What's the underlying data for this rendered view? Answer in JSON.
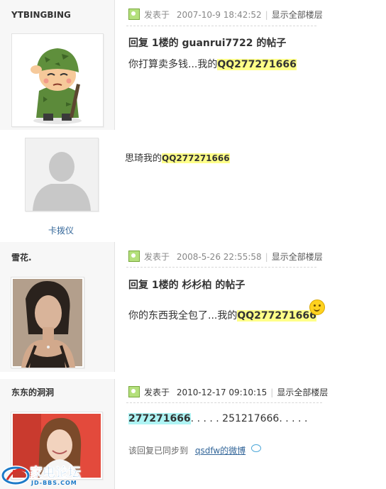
{
  "posts": [
    {
      "username": "YTBINGBING",
      "posted_prefix": "发表于",
      "posted_time": "2007-10-9 18:42:52",
      "show_all": "显示全部楼层",
      "title": "回复  1楼的  guanrui7722 的帖子",
      "body_prefix": "你打算卖多钱...我的",
      "body_qq": "QQ277271666"
    },
    {
      "username": "卡拨仪",
      "body_prefix": "思琦我的",
      "body_qq": "QQ277271666"
    },
    {
      "username": "雪花.",
      "posted_prefix": "发表于",
      "posted_time": "2008-5-26 22:55:58",
      "show_all": "显示全部楼层",
      "title": "回复  1楼的  杉杉柏  的帖子",
      "body_prefix": "你的东西我全包了...我的",
      "body_qq": "QQ277271666"
    },
    {
      "username": "东东的洞洞",
      "posted_prefix": "发表于",
      "posted_time": "2010-12-17 09:10:15",
      "show_all": "显示全部楼层",
      "body_qq": "277271666",
      "body_rest": ". .  .  .  .  251217666. .  .  .  .",
      "sync_prefix": "该回复已同步到",
      "sync_link": "qsdfw的微博"
    }
  ],
  "watermark": {
    "logo_text": "家电论坛",
    "logo_sub": "JD-BBS.COM"
  },
  "colors": {
    "qq_highlight": "#ffff88",
    "qq_highlight_cyan": "#aef4f4",
    "link": "#336699",
    "sidebar_bg": "#f7f7f7"
  }
}
